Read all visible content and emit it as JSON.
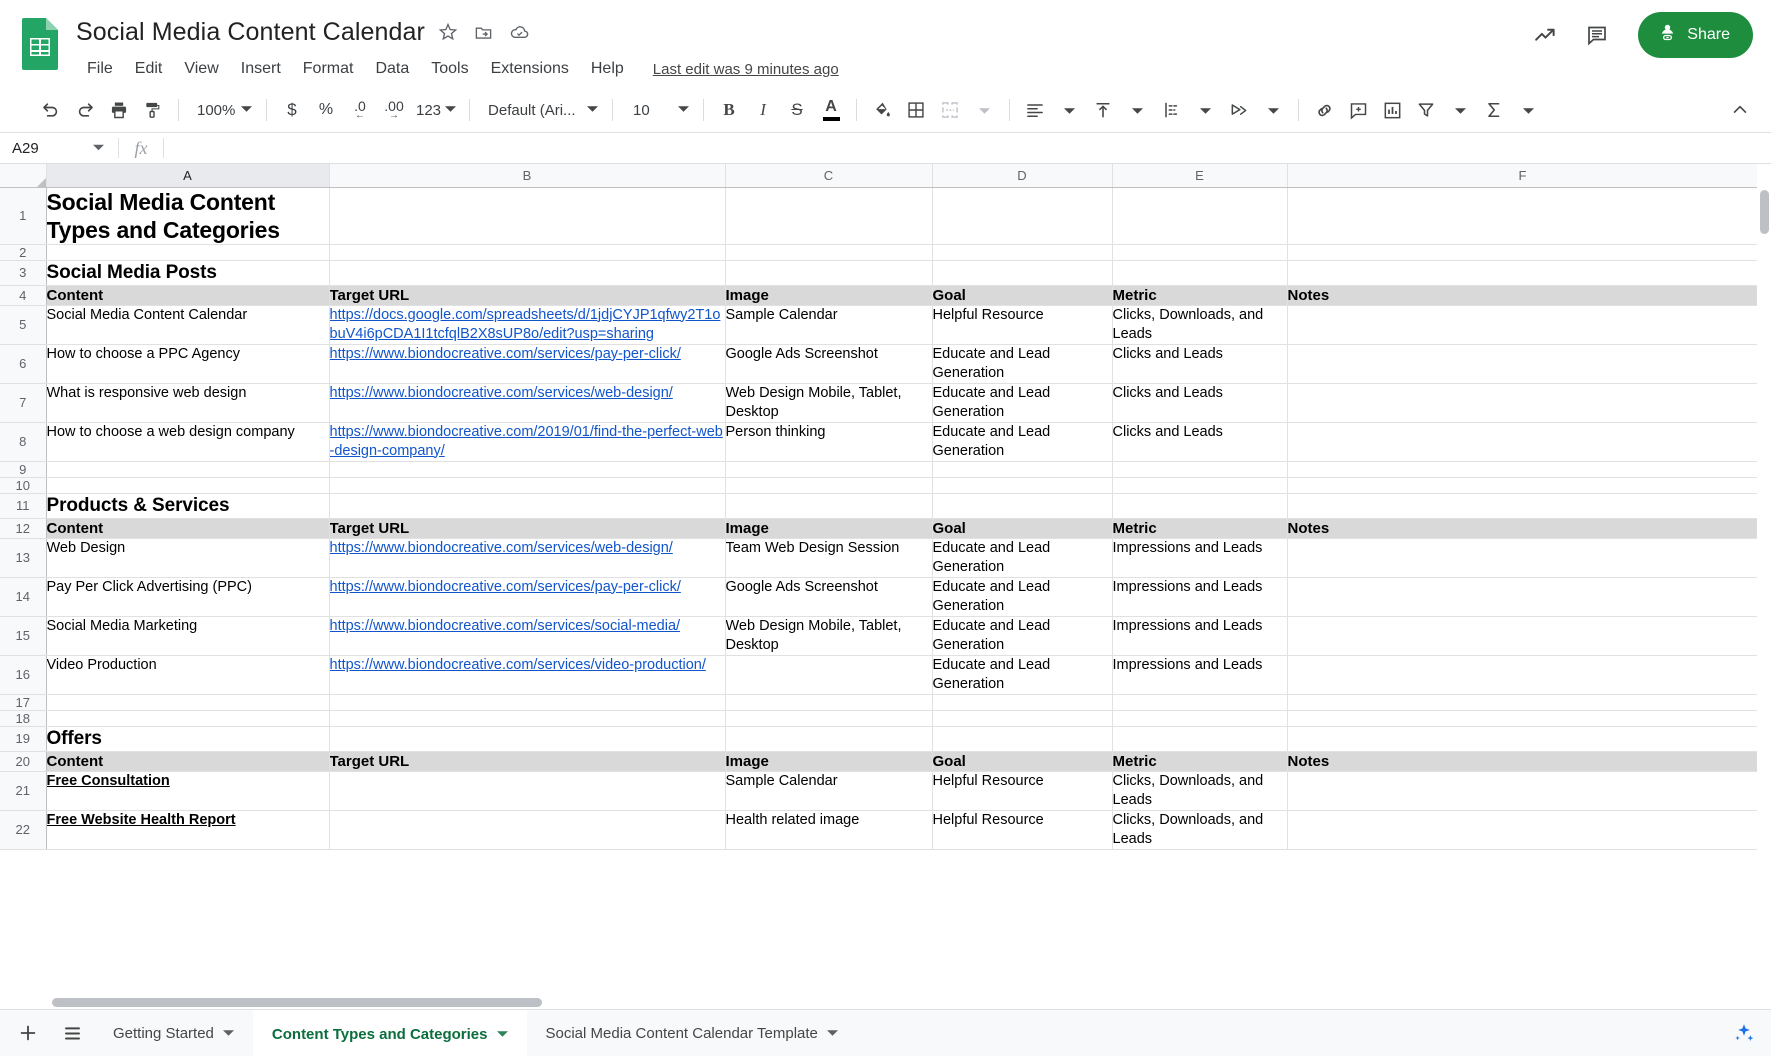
{
  "header": {
    "doc_title": "Social Media Content Calendar",
    "star_icon": "star-icon",
    "move_icon": "move-to-folder-icon",
    "cloud_icon": "cloud-saved-icon",
    "menus": [
      "File",
      "Edit",
      "View",
      "Insert",
      "Format",
      "Data",
      "Tools",
      "Extensions",
      "Help"
    ],
    "last_edit": "Last edit was 9 minutes ago",
    "trend_icon": "activity-trend-icon",
    "comment_icon": "comment-history-icon",
    "share_label": "Share",
    "share_color": "#1e8e3e"
  },
  "toolbar": {
    "undo": "undo-icon",
    "redo": "redo-icon",
    "print": "print-icon",
    "paint_format": "paint-format-icon",
    "zoom_value": "100%",
    "currency": "$",
    "percent": "%",
    "decrease_decimal": ".0",
    "increase_decimal": ".00",
    "more_formats": "123",
    "font_value": "Default (Ari...",
    "font_size_value": "10",
    "bold": "B",
    "italic": "I",
    "strikethrough": "S",
    "text_color": "A",
    "fill_color": "fill-color-icon",
    "borders": "borders-icon",
    "merge_cells": "merge-cells-icon",
    "horizontal_align": "horizontal-align-icon",
    "vertical_align": "vertical-align-icon",
    "text_wrap": "text-wrapping-icon",
    "text_rotation": "text-rotation-icon",
    "insert_link": "insert-link-icon",
    "insert_comment": "insert-comment-icon",
    "insert_chart": "insert-chart-icon",
    "create_filter": "filter-icon",
    "functions": "functions-sigma-icon",
    "collapse": "collapse-toolbar-icon"
  },
  "formula_bar": {
    "name_box": "A29",
    "fx_label": "fx",
    "formula_value": ""
  },
  "grid": {
    "columns": [
      "A",
      "B",
      "C",
      "D",
      "E",
      "F"
    ],
    "selected_column": "A",
    "rows": [
      {
        "n": "1",
        "cells": [
          {
            "v": "Social Media Content Types and Categories",
            "style": "bigtitle"
          },
          {
            "v": ""
          },
          {
            "v": ""
          },
          {
            "v": ""
          },
          {
            "v": ""
          },
          {
            "v": ""
          }
        ]
      },
      {
        "n": "2",
        "cells": [
          {
            "v": ""
          },
          {
            "v": ""
          },
          {
            "v": ""
          },
          {
            "v": ""
          },
          {
            "v": ""
          },
          {
            "v": ""
          }
        ]
      },
      {
        "n": "3",
        "cells": [
          {
            "v": "Social Media Posts",
            "style": "sectitle"
          },
          {
            "v": ""
          },
          {
            "v": ""
          },
          {
            "v": ""
          },
          {
            "v": ""
          },
          {
            "v": ""
          }
        ]
      },
      {
        "n": "4",
        "cells": [
          {
            "v": "Content",
            "style": "hdr"
          },
          {
            "v": "Target URL",
            "style": "hdr"
          },
          {
            "v": "Image",
            "style": "hdr"
          },
          {
            "v": "Goal",
            "style": "hdr"
          },
          {
            "v": "Metric",
            "style": "hdr"
          },
          {
            "v": "Notes",
            "style": "hdr"
          }
        ]
      },
      {
        "n": "5",
        "cells": [
          {
            "v": "Social Media Content Calendar"
          },
          {
            "v": "https://docs.google.com/spreadsheets/d/1jdjCYJP1qfwy2T1obuV4i6pCDA1I1tcfqlB2X8sUP8o/edit?usp=sharing",
            "style": "lnk"
          },
          {
            "v": "Sample Calendar"
          },
          {
            "v": "Helpful Resource"
          },
          {
            "v": "Clicks, Downloads, and Leads"
          },
          {
            "v": ""
          }
        ]
      },
      {
        "n": "6",
        "cells": [
          {
            "v": "How to choose a PPC Agency"
          },
          {
            "v": "https://www.biondocreative.com/services/pay-per-click/",
            "style": "lnk"
          },
          {
            "v": "Google Ads Screenshot"
          },
          {
            "v": "Educate and Lead Generation"
          },
          {
            "v": "Clicks and Leads"
          },
          {
            "v": ""
          }
        ]
      },
      {
        "n": "7",
        "cells": [
          {
            "v": "What is responsive web design"
          },
          {
            "v": "https://www.biondocreative.com/services/web-design/",
            "style": "lnk"
          },
          {
            "v": "Web Design Mobile, Tablet, Desktop"
          },
          {
            "v": "Educate and Lead Generation"
          },
          {
            "v": "Clicks and Leads"
          },
          {
            "v": ""
          }
        ]
      },
      {
        "n": "8",
        "cells": [
          {
            "v": "How to choose a web design company"
          },
          {
            "v": "https://www.biondocreative.com/2019/01/find-the-perfect-web-design-company/",
            "style": "lnk"
          },
          {
            "v": "Person thinking"
          },
          {
            "v": "Educate and Lead Generation"
          },
          {
            "v": "Clicks and Leads"
          },
          {
            "v": ""
          }
        ]
      },
      {
        "n": "9",
        "cells": [
          {
            "v": ""
          },
          {
            "v": ""
          },
          {
            "v": ""
          },
          {
            "v": ""
          },
          {
            "v": ""
          },
          {
            "v": ""
          }
        ]
      },
      {
        "n": "10",
        "cells": [
          {
            "v": ""
          },
          {
            "v": ""
          },
          {
            "v": ""
          },
          {
            "v": ""
          },
          {
            "v": ""
          },
          {
            "v": ""
          }
        ]
      },
      {
        "n": "11",
        "cells": [
          {
            "v": "Products & Services",
            "style": "sectitle"
          },
          {
            "v": ""
          },
          {
            "v": ""
          },
          {
            "v": ""
          },
          {
            "v": ""
          },
          {
            "v": ""
          }
        ]
      },
      {
        "n": "12",
        "cells": [
          {
            "v": "Content",
            "style": "hdr"
          },
          {
            "v": "Target URL",
            "style": "hdr"
          },
          {
            "v": "Image",
            "style": "hdr"
          },
          {
            "v": "Goal",
            "style": "hdr"
          },
          {
            "v": "Metric",
            "style": "hdr"
          },
          {
            "v": "Notes",
            "style": "hdr"
          }
        ]
      },
      {
        "n": "13",
        "cells": [
          {
            "v": "Web Design"
          },
          {
            "v": "https://www.biondocreative.com/services/web-design/",
            "style": "lnk"
          },
          {
            "v": "Team Web Design Session"
          },
          {
            "v": "Educate and Lead Generation"
          },
          {
            "v": "Impressions and Leads"
          },
          {
            "v": ""
          }
        ]
      },
      {
        "n": "14",
        "cells": [
          {
            "v": "Pay Per Click Advertising (PPC)"
          },
          {
            "v": "https://www.biondocreative.com/services/pay-per-click/",
            "style": "lnk"
          },
          {
            "v": "Google Ads Screenshot"
          },
          {
            "v": "Educate and Lead Generation"
          },
          {
            "v": "Impressions and Leads"
          },
          {
            "v": ""
          }
        ]
      },
      {
        "n": "15",
        "cells": [
          {
            "v": "Social Media Marketing"
          },
          {
            "v": "https://www.biondocreative.com/services/social-media/",
            "style": "lnk"
          },
          {
            "v": "Web Design Mobile, Tablet, Desktop"
          },
          {
            "v": "Educate and Lead Generation"
          },
          {
            "v": "Impressions and Leads"
          },
          {
            "v": ""
          }
        ]
      },
      {
        "n": "16",
        "cells": [
          {
            "v": "Video Production"
          },
          {
            "v": "https://www.biondocreative.com/services/video-production/",
            "style": "lnk"
          },
          {
            "v": ""
          },
          {
            "v": "Educate and Lead Generation"
          },
          {
            "v": "Impressions and Leads"
          },
          {
            "v": ""
          }
        ]
      },
      {
        "n": "17",
        "cells": [
          {
            "v": ""
          },
          {
            "v": ""
          },
          {
            "v": ""
          },
          {
            "v": ""
          },
          {
            "v": ""
          },
          {
            "v": ""
          }
        ]
      },
      {
        "n": "18",
        "cells": [
          {
            "v": ""
          },
          {
            "v": ""
          },
          {
            "v": ""
          },
          {
            "v": ""
          },
          {
            "v": ""
          },
          {
            "v": ""
          }
        ]
      },
      {
        "n": "19",
        "cells": [
          {
            "v": "Offers",
            "style": "sectitle"
          },
          {
            "v": ""
          },
          {
            "v": ""
          },
          {
            "v": ""
          },
          {
            "v": ""
          },
          {
            "v": ""
          }
        ]
      },
      {
        "n": "20",
        "cells": [
          {
            "v": "Content",
            "style": "hdr"
          },
          {
            "v": "Target URL",
            "style": "hdr"
          },
          {
            "v": "Image",
            "style": "hdr"
          },
          {
            "v": "Goal",
            "style": "hdr"
          },
          {
            "v": "Metric",
            "style": "hdr"
          },
          {
            "v": "Notes",
            "style": "hdr"
          }
        ]
      },
      {
        "n": "21",
        "cells": [
          {
            "v": "Free Consultation",
            "style": "bold-underline"
          },
          {
            "v": ""
          },
          {
            "v": "Sample Calendar"
          },
          {
            "v": "Helpful Resource"
          },
          {
            "v": "Clicks, Downloads, and Leads"
          },
          {
            "v": ""
          }
        ]
      },
      {
        "n": "22",
        "cells": [
          {
            "v": "Free Website Health Report",
            "style": "bold-underline"
          },
          {
            "v": ""
          },
          {
            "v": "Health related image"
          },
          {
            "v": "Helpful Resource"
          },
          {
            "v": "Clicks, Downloads, and Leads"
          },
          {
            "v": ""
          }
        ]
      }
    ]
  },
  "sheetbar": {
    "add_sheet": "add-sheet-icon",
    "all_sheets": "all-sheets-icon",
    "tabs": [
      {
        "label": "Getting Started",
        "active": false
      },
      {
        "label": "Content Types and Categories",
        "active": true
      },
      {
        "label": "Social Media Content Calendar Template",
        "active": false
      }
    ],
    "explore": "explore-icon",
    "active_tab_color": "#0b6e3c"
  }
}
